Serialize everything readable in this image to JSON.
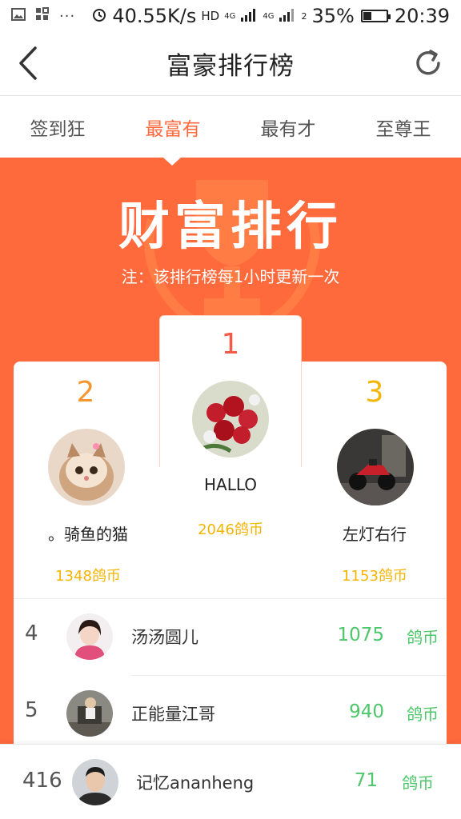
{
  "status_bar": {
    "speed": "40.55K/s",
    "network": "HD",
    "net_small_1": "4G",
    "net_small_2": "4G",
    "sim2": "2",
    "battery": "35%",
    "time": "20:39",
    "icons": [
      "gallery-icon",
      "grid-icon",
      "more-icon",
      "alarm-icon",
      "signal-icon",
      "battery-icon"
    ]
  },
  "header": {
    "title": "富豪排行榜",
    "back_icon": "back-arrow-icon",
    "refresh_icon": "refresh-icon"
  },
  "tabs": [
    {
      "label": "签到狂",
      "active": false
    },
    {
      "label": "最富有",
      "active": true
    },
    {
      "label": "最有才",
      "active": false
    },
    {
      "label": "至尊王",
      "active": false
    }
  ],
  "hero": {
    "title": "财富排行",
    "note": "注：该排行榜每1小时更新一次",
    "accent": "#ff6a3d"
  },
  "podium": {
    "first": {
      "rank": "1",
      "name": "HALLO",
      "coins": "2046鸽币",
      "rank_color": "#f25a4a"
    },
    "second": {
      "rank": "2",
      "name": "。骑鱼的猫",
      "coins": "1348鸽币",
      "rank_color": "#f5962e"
    },
    "third": {
      "rank": "3",
      "name": "左灯右行",
      "coins": "1153鸽币",
      "rank_color": "#f5b400"
    }
  },
  "list": [
    {
      "rank": "4",
      "name": "汤汤圆儿",
      "value": "1075",
      "unit": "鸽币"
    },
    {
      "rank": "5",
      "name": "正能量江哥",
      "value": "940",
      "unit": "鸽币"
    }
  ],
  "my_rank": {
    "rank": "416",
    "name": "记忆ananheng",
    "value": "71",
    "unit": "鸽币"
  }
}
